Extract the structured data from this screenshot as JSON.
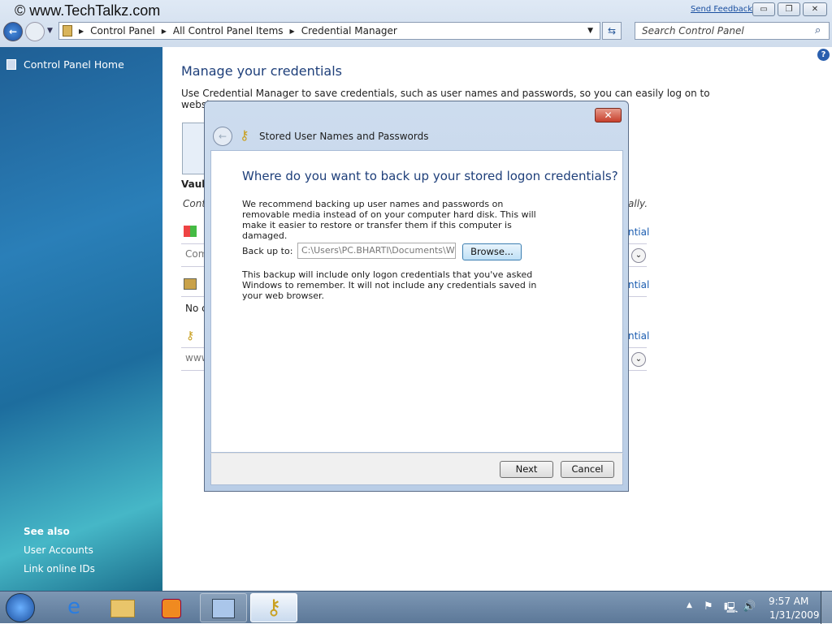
{
  "watermark": "© www.TechTalkz.com",
  "header": {
    "send_feedback": "Send Feedback",
    "minimize": "▭",
    "restore": "❐",
    "close": "✕"
  },
  "address": {
    "crumbs": [
      "Control Panel",
      "All Control Panel Items",
      "Credential Manager"
    ],
    "search_placeholder": "Search Control Panel"
  },
  "sidebar": {
    "home": "Control Panel Home",
    "see_also": "See also",
    "links": [
      "User Accounts",
      "Link online IDs"
    ]
  },
  "main": {
    "title": "Manage your credentials",
    "desc": "Use Credential Manager to save credentials, such as user names and passwords, so you can easily log on to",
    "desc2": "websi",
    "vault": "Vault",
    "cont": "Cont",
    "ally": "ally.",
    "ntial": "ntial",
    "com": "Com",
    "noc": "No c",
    "www": "www"
  },
  "dialog": {
    "title": "Stored User Names and Passwords",
    "heading": "Where do you want to back up your stored logon credentials?",
    "para1": "We recommend backing up user names and passwords on removable media instead of on your computer hard disk. This will make it easier to restore or transfer them if this computer is damaged.",
    "backup_label": "Back up to:",
    "backup_value": "C:\\Users\\PC.BHARTI\\Documents\\Win V",
    "browse": "Browse...",
    "para2": "This backup will include only logon credentials that you've asked Windows to remember. It will not include any credentials saved in your web browser.",
    "next": "Next",
    "cancel": "Cancel"
  },
  "taskbar": {
    "time": "9:57 AM",
    "date": "1/31/2009"
  }
}
